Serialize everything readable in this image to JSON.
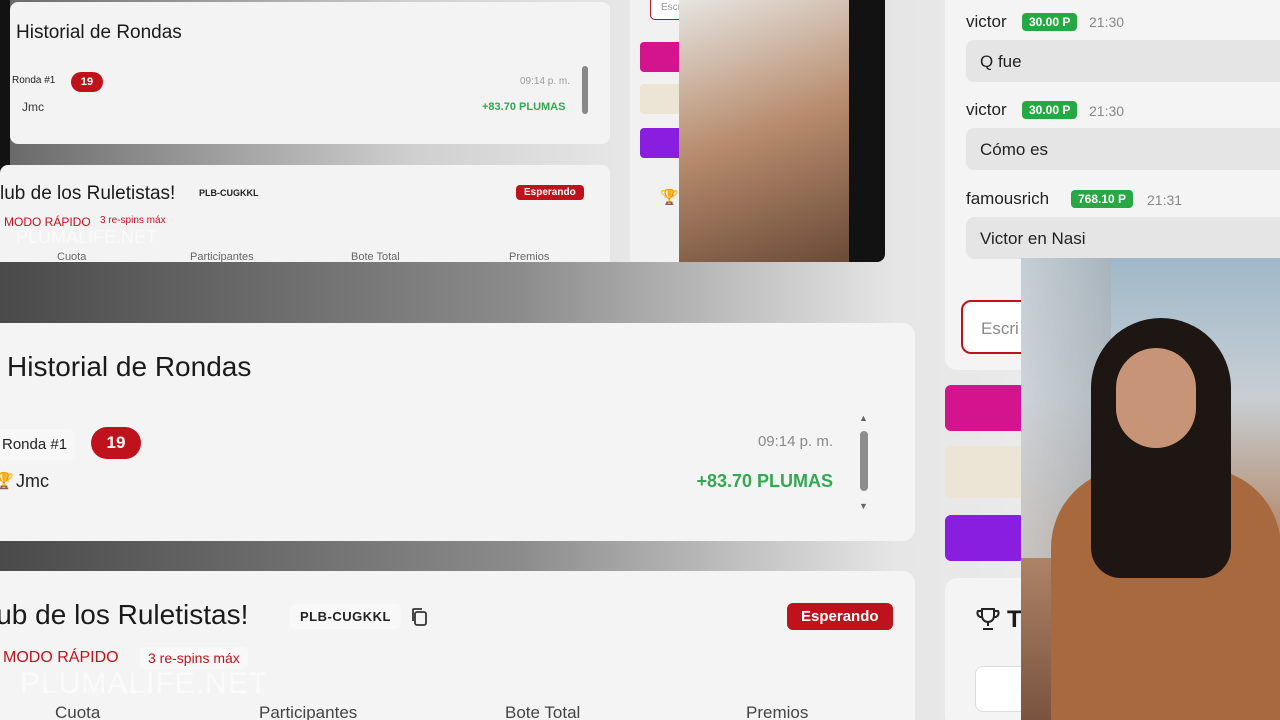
{
  "history": {
    "title": "Historial de Rondas",
    "round_label": "Ronda #1",
    "round_count": "19",
    "player": "Jmc",
    "time": "09:14 p. m.",
    "gain": "+83.70 PLUMAS"
  },
  "club": {
    "name": "lub de los Ruletistas!",
    "code": "PLB-CUGKKL",
    "status": "Esperando",
    "mode": "MODO RÁPIDO",
    "respins": "3 re-spins máx",
    "watermark": "PLUMALIFE.NET",
    "columns": [
      "Cuota",
      "Participantes",
      "Bote Total",
      "Premios"
    ]
  },
  "thumbnail": {
    "search_placeholder": "Escri",
    "trophy_partial": "T"
  },
  "chat": {
    "messages": [
      {
        "user": "victor",
        "points": "30.00 P",
        "time": "21:30",
        "text": "Q fue"
      },
      {
        "user": "victor",
        "points": "30.00 P",
        "time": "21:30",
        "text": "Cómo es"
      },
      {
        "user": "famousrich",
        "points": "768.10 P",
        "time": "21:31",
        "text": "Victor en Nasi"
      }
    ],
    "input_placeholder": "Escri"
  },
  "prizes_partial_title": "T",
  "colors": {
    "accent_red": "#c0121c",
    "gain_green": "#32a852",
    "points_green": "#28a745",
    "magenta": "#d4148f",
    "beige": "#ece4d4",
    "purple": "#8a1ee0"
  }
}
